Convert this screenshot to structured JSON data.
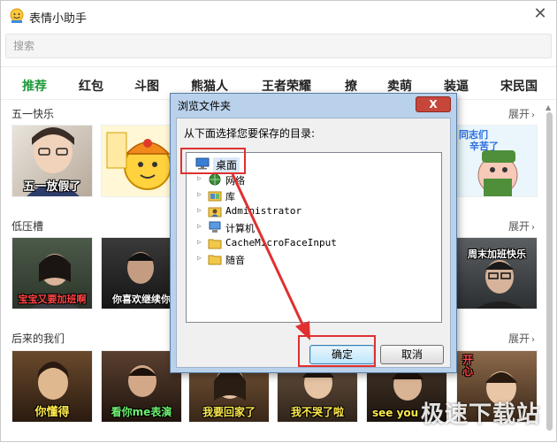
{
  "app": {
    "title": "表情小助手"
  },
  "search": {
    "placeholder": "搜索"
  },
  "tabs": [
    "推荐",
    "红包",
    "斗图",
    "熊猫人",
    "王者荣耀",
    "撩",
    "卖萌",
    "装逼",
    "宋民国"
  ],
  "sections": [
    {
      "title": "五一快乐",
      "expand": "展开",
      "captions": [
        "五一放假了",
        "",
        "",
        "",
        "",
        ""
      ]
    },
    {
      "title": "低压槽",
      "expand": "展开",
      "captions": [
        "宝宝又要加班啊",
        "你喜欢继续你",
        "",
        "",
        "",
        "周末加班快乐"
      ]
    },
    {
      "title": "后来的我们",
      "expand": "展开",
      "captions": [
        "你懂得",
        "看你me表演",
        "我要回家了",
        "我不哭了啦",
        "see you",
        "开心"
      ]
    }
  ],
  "dialog": {
    "title": "浏览文件夹",
    "close": "X",
    "prompt": "从下面选择您要保存的目录:",
    "tree": [
      {
        "label": "桌面",
        "icon": "desktop-icon",
        "selected": true
      },
      {
        "label": "网络",
        "icon": "network-icon"
      },
      {
        "label": "库",
        "icon": "library-icon"
      },
      {
        "label": "Administrator",
        "icon": "user-folder-icon"
      },
      {
        "label": "计算机",
        "icon": "computer-icon"
      },
      {
        "label": "CacheMicroFaceInput",
        "icon": "folder-icon"
      },
      {
        "label": "随音",
        "icon": "folder-icon"
      }
    ],
    "ok": "确定",
    "cancel": "取消"
  },
  "extra_labels": {
    "thumb_text_1": "同志们",
    "thumb_text_2": "辛苦了"
  },
  "watermark": "极速下载站",
  "colors": {
    "active_tab": "#1f9a3b",
    "annotation": "#e03030",
    "dialog_frame": "#b9d1ea"
  }
}
